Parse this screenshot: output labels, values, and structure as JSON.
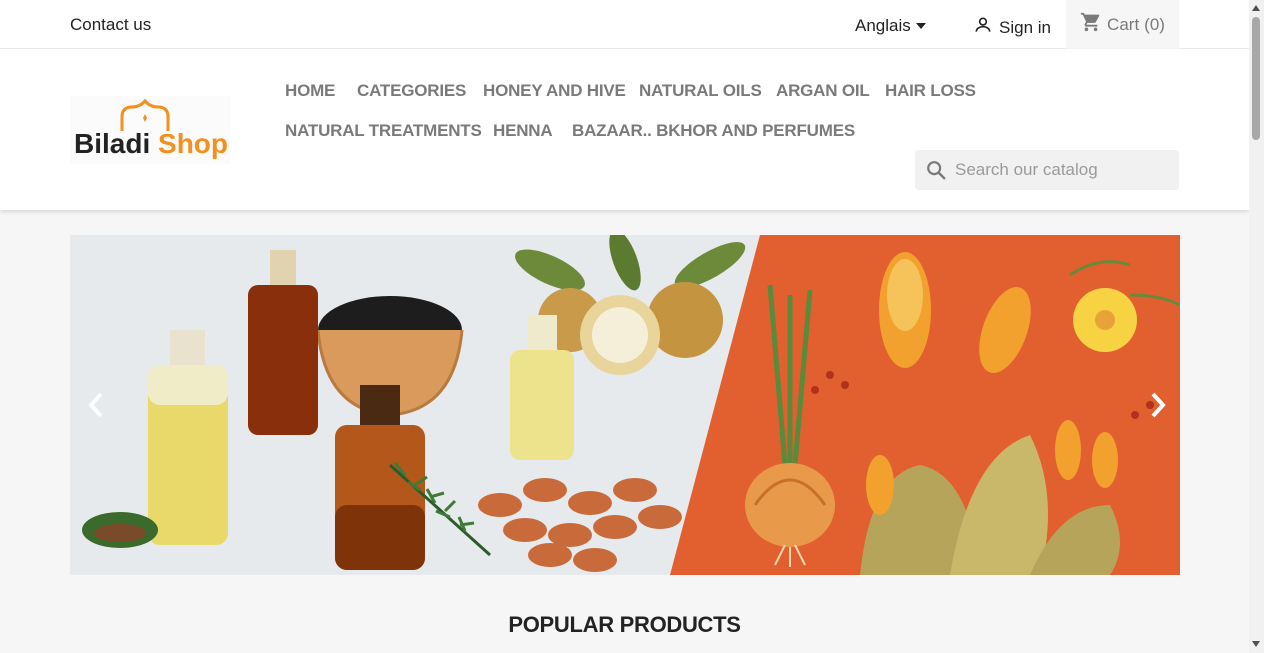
{
  "topbar": {
    "contact": "Contact us",
    "language": "Anglais",
    "signin": "Sign in",
    "cart": "Cart",
    "cart_count": "(0)"
  },
  "logo": {
    "part1": "Biladi",
    "part2": "Shop"
  },
  "nav": {
    "items": [
      "HOME",
      "CATEGORIES",
      "HONEY AND HIVE",
      "NATURAL OILS",
      "ARGAN OIL",
      "HAIR LOSS",
      "NATURAL TREATMENTS",
      "HENNA",
      "BAZAAR.. BKHOR AND PERFUMES"
    ]
  },
  "search": {
    "placeholder": "Search our catalog"
  },
  "slider": {
    "prev_icon": "chevron-left-icon",
    "next_icon": "chevron-right-icon"
  },
  "sections": {
    "popular": "POPULAR PRODUCTS"
  },
  "colors": {
    "accent": "#f39120",
    "banner_orange": "#e25f2f",
    "nav_text": "#7a7a7a"
  }
}
